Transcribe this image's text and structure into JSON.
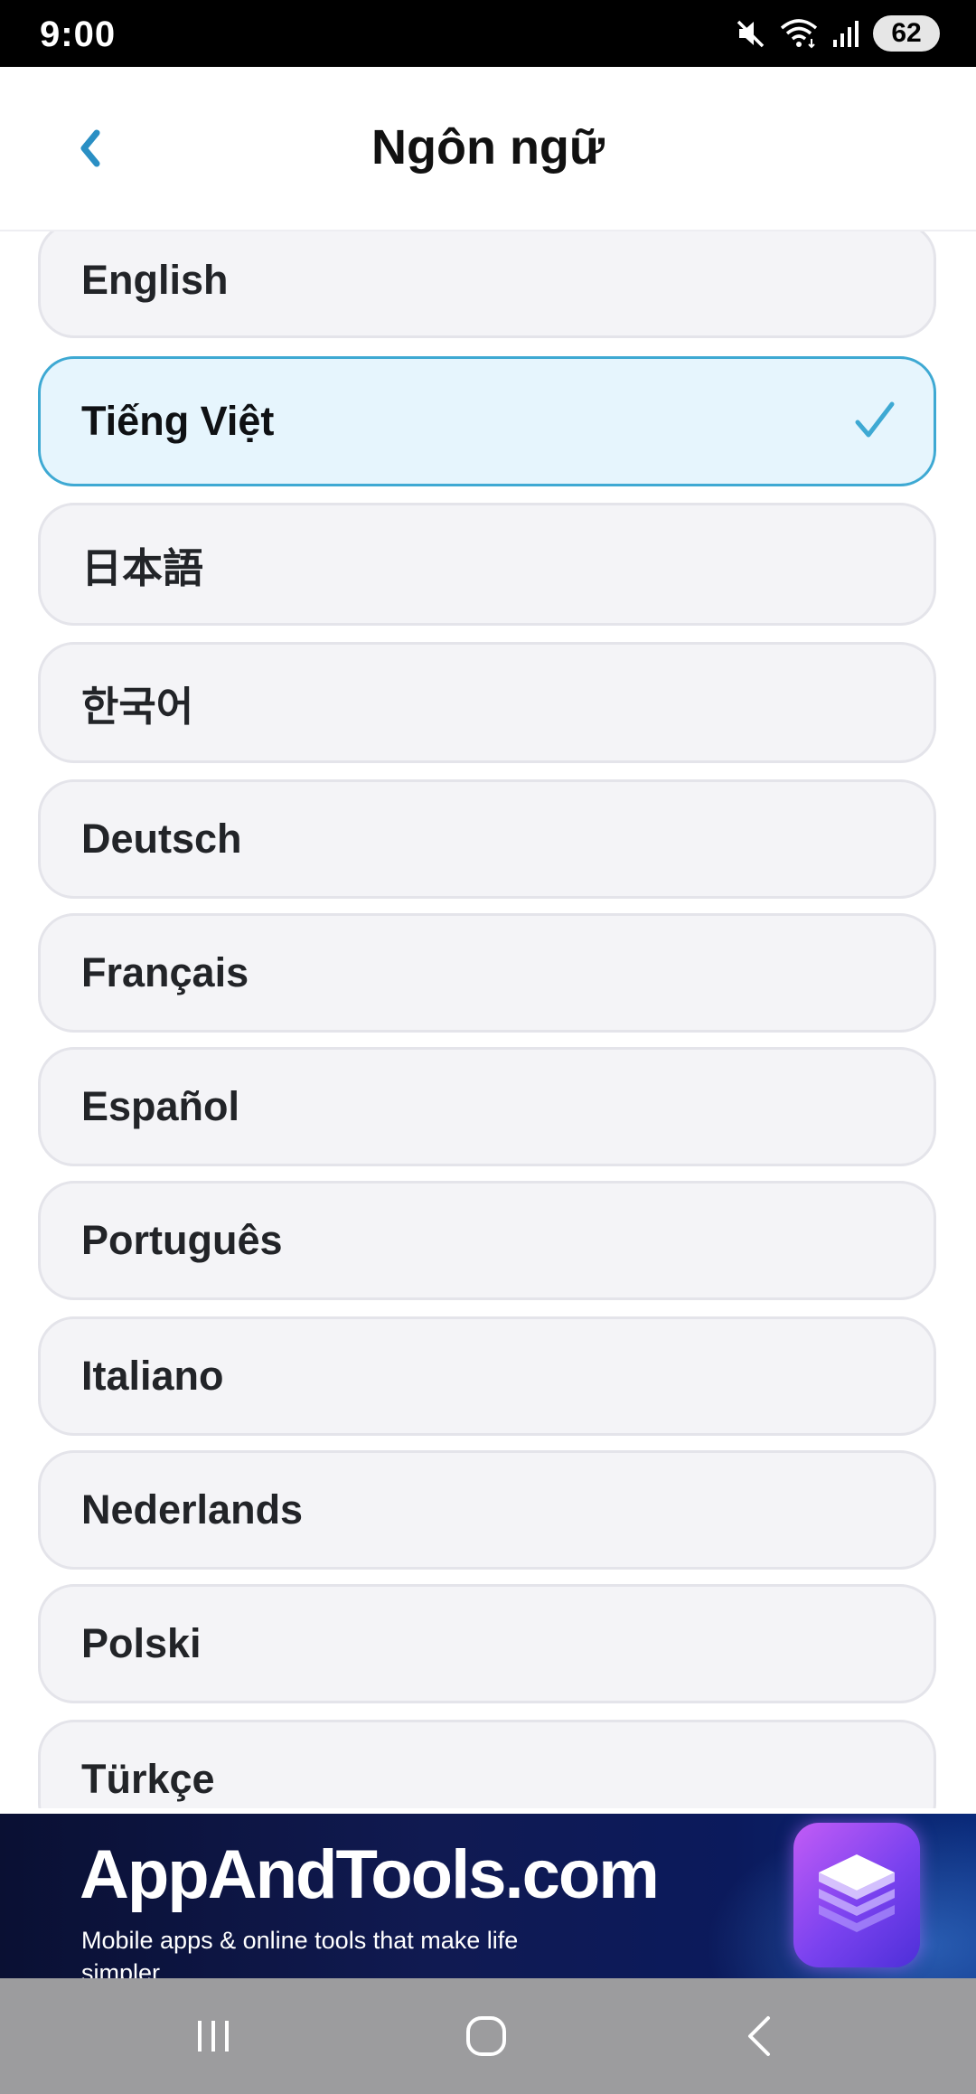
{
  "status_bar": {
    "time": "9:00",
    "battery": "62",
    "icons": [
      "mute-icon",
      "wifi-icon",
      "signal-icon",
      "battery-icon"
    ]
  },
  "header": {
    "title": "Ngôn ngữ",
    "back_icon": "chevron-left-icon"
  },
  "languages": [
    {
      "label": "English",
      "selected": false
    },
    {
      "label": "Tiếng Việt",
      "selected": true
    },
    {
      "label": "日本語",
      "selected": false
    },
    {
      "label": "한국어",
      "selected": false
    },
    {
      "label": "Deutsch",
      "selected": false
    },
    {
      "label": "Français",
      "selected": false
    },
    {
      "label": "Español",
      "selected": false
    },
    {
      "label": "Português",
      "selected": false
    },
    {
      "label": "Italiano",
      "selected": false
    },
    {
      "label": "Nederlands",
      "selected": false
    },
    {
      "label": "Polski",
      "selected": false
    },
    {
      "label": "Türkçe",
      "selected": false
    }
  ],
  "ad": {
    "title": "AppAndTools.com",
    "subtitle": "Mobile apps & online tools that make life simpler",
    "logo_icon": "layers-icon"
  },
  "nav": {
    "icons": [
      "recent-apps-icon",
      "home-icon",
      "back-icon"
    ]
  },
  "colors": {
    "accent": "#3ea9d3",
    "selected_bg": "#e6f5fd",
    "item_bg": "#f4f4f7"
  }
}
